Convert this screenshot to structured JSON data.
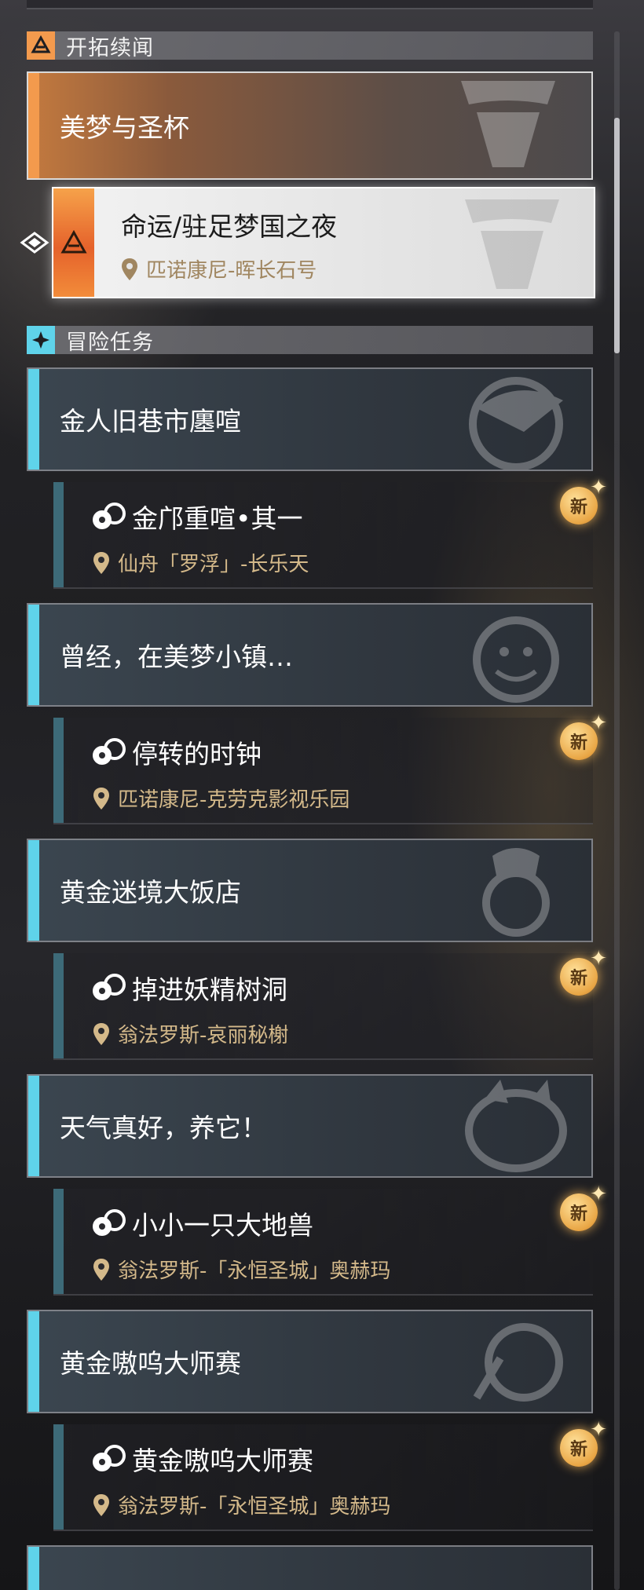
{
  "colors": {
    "adventure_accent": "#5fd3ea",
    "story_accent": "#f39a4d",
    "location_text": "#d4b98a",
    "new_badge": "#e9a645"
  },
  "sections": {
    "story": {
      "title": "开拓续闻",
      "icon": "trailblaze-icon"
    },
    "adventure": {
      "title": "冒险任务",
      "icon": "star-diamond-icon"
    }
  },
  "story_group": {
    "title": "美梦与圣杯",
    "selected_quest": {
      "title": "命运/驻足梦国之夜",
      "location": "匹诺康尼-晖长石号"
    }
  },
  "adventure_groups": [
    {
      "title": "金人旧巷市廛喧",
      "quest": {
        "title": "金邝重喧•其一",
        "location": "仙舟「罗浮」-长乐天",
        "badge": "新"
      }
    },
    {
      "title": "曾经，在美梦小镇…",
      "quest": {
        "title": "停转的时钟",
        "location": "匹诺康尼-克劳克影视乐园",
        "badge": "新"
      }
    },
    {
      "title": "黄金迷境大饭店",
      "quest": {
        "title": "掉进妖精树洞",
        "location": "翁法罗斯-哀丽秘榭",
        "badge": "新"
      }
    },
    {
      "title": "天气真好，养它！",
      "quest": {
        "title": "小小一只大地兽",
        "location": "翁法罗斯-「永恒圣城」奥赫玛",
        "badge": "新"
      }
    },
    {
      "title": "黄金嗷呜大师赛",
      "quest": {
        "title": "黄金嗷呜大师赛",
        "location": "翁法罗斯-「永恒圣城」奥赫玛",
        "badge": "新"
      }
    }
  ]
}
